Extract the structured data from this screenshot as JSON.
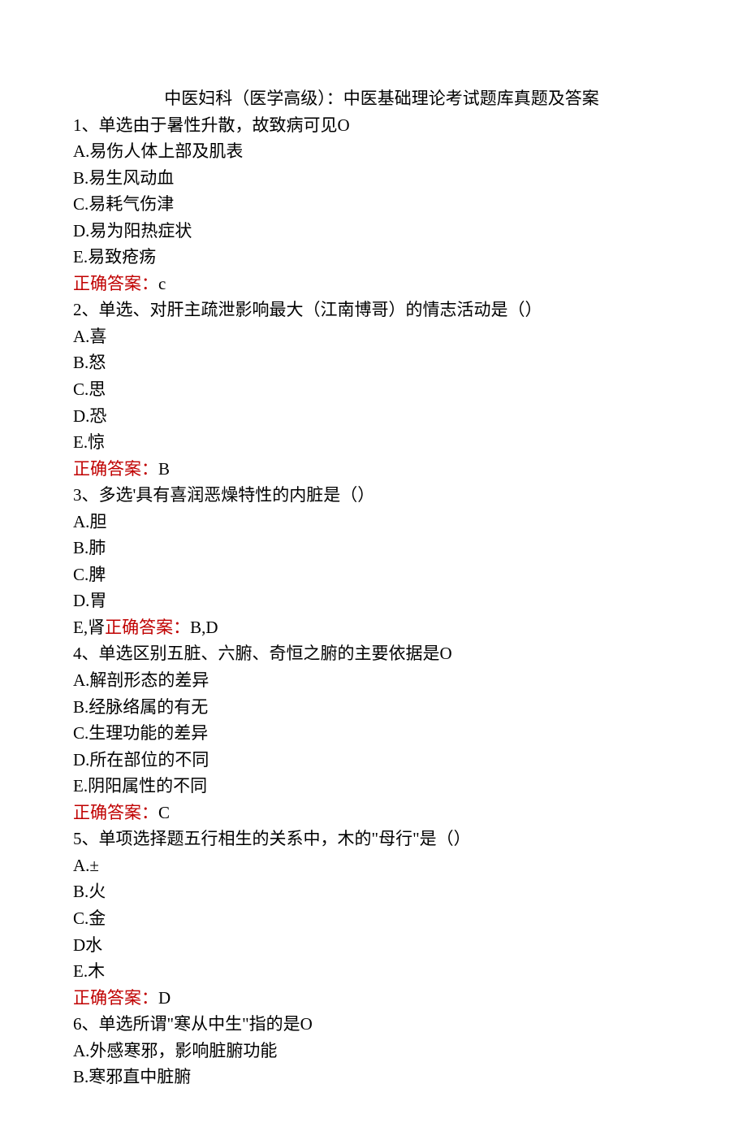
{
  "title": "中医妇科（医学高级）：中医基础理论考试题库真题及答案",
  "questions": [
    {
      "stem": "1、单选由于暑性升散，故致病可见O",
      "options": [
        "A.易伤人体上部及肌表",
        "B.易生风动血",
        "C.易耗气伤津",
        "D.易为阳热症状",
        "E.易致疮疡"
      ],
      "answer_label": "正确答案：",
      "answer_value": "c",
      "inline_answer": false
    },
    {
      "stem": "2、单选、对肝主疏泄影响最大（江南博哥）的情志活动是（）",
      "options": [
        "A.喜",
        "B.怒",
        "C.思",
        "D.恐",
        "E.惊"
      ],
      "answer_label": "正确答案：",
      "answer_value": "B",
      "inline_answer": false
    },
    {
      "stem": "3、多选'具有喜润恶燥特性的内脏是（）",
      "options": [
        "A.胆",
        "B.肺",
        "C.脾",
        "D.胃"
      ],
      "inline_last_option": "E,肾",
      "answer_label": "正确答案：",
      "answer_value": "B,D",
      "inline_answer": true
    },
    {
      "stem": "4、单选区别五脏、六腑、奇恒之腑的主要依据是O",
      "options": [
        "A.解剖形态的差异",
        "B.经脉络属的有无",
        "C.生理功能的差异",
        "D.所在部位的不同",
        "E.阴阳属性的不同"
      ],
      "answer_label": "正确答案：",
      "answer_value": "C",
      "inline_answer": false
    },
    {
      "stem": "5、单项选择题五行相生的关系中，木的\"母行\"是（）",
      "options": [
        "A.±",
        "B.火",
        "C.金",
        "D水",
        "E.木"
      ],
      "answer_label": "正确答案：",
      "answer_value": "D",
      "inline_answer": false
    },
    {
      "stem": "6、单选所谓\"寒从中生\"指的是O",
      "options": [
        "A.外感寒邪，影响脏腑功能",
        "B.寒邪直中脏腑"
      ],
      "answer_label": "",
      "answer_value": "",
      "inline_answer": false
    }
  ]
}
